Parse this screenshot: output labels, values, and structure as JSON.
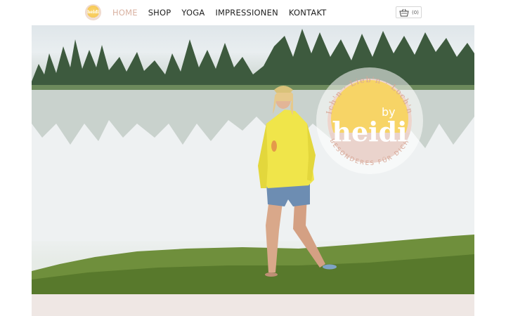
{
  "header": {
    "logo_text": "heidi",
    "nav": [
      {
        "label": "HOME",
        "active": true
      },
      {
        "label": "SHOP",
        "active": false
      },
      {
        "label": "YOGA",
        "active": false
      },
      {
        "label": "IMPRESSIONEN",
        "active": false
      },
      {
        "label": "KONTAKT",
        "active": false
      }
    ],
    "cart_count": "(0)"
  },
  "hero": {
    "badge": {
      "top_arc_text": "Ich'n · Lieb'n · Loch'n",
      "bottom_arc_text": "BESONDERES FÜR DICH",
      "by": "by",
      "name": "heidi"
    }
  },
  "colors": {
    "accent": "#d9b2a2",
    "sun": "#f7d466",
    "badge_pink": "#e8d3cc",
    "footer_strip": "#efe7e4"
  }
}
